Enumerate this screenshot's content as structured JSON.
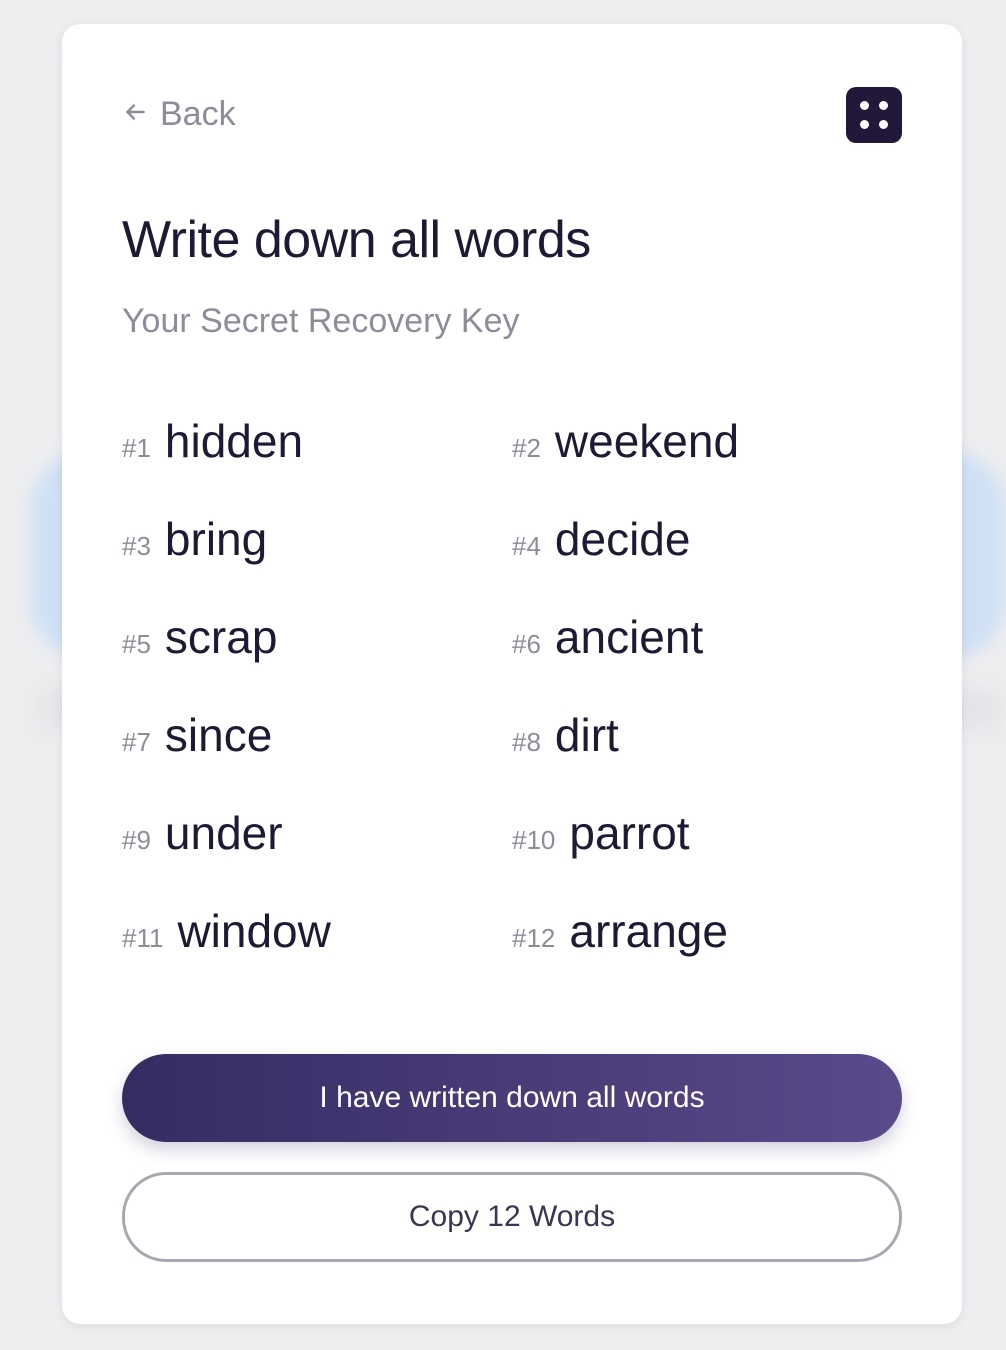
{
  "header": {
    "back_label": "Back",
    "back_icon": "arrow-left-icon",
    "menu_icon": "four-dots-icon"
  },
  "title": "Write down all words",
  "subtitle": "Your Secret Recovery Key",
  "words": [
    {
      "num": "#1",
      "word": "hidden"
    },
    {
      "num": "#2",
      "word": "weekend"
    },
    {
      "num": "#3",
      "word": "bring"
    },
    {
      "num": "#4",
      "word": "decide"
    },
    {
      "num": "#5",
      "word": "scrap"
    },
    {
      "num": "#6",
      "word": "ancient"
    },
    {
      "num": "#7",
      "word": "since"
    },
    {
      "num": "#8",
      "word": "dirt"
    },
    {
      "num": "#9",
      "word": "under"
    },
    {
      "num": "#10",
      "word": "parrot"
    },
    {
      "num": "#11",
      "word": "window"
    },
    {
      "num": "#12",
      "word": "arrange"
    }
  ],
  "actions": {
    "confirm_label": "I have written down all words",
    "copy_label": "Copy 12 Words"
  },
  "colors": {
    "primary_start": "#362c63",
    "primary_end": "#5a4a8a",
    "text_dark": "#1f1933",
    "text_muted": "#8e8c99"
  }
}
